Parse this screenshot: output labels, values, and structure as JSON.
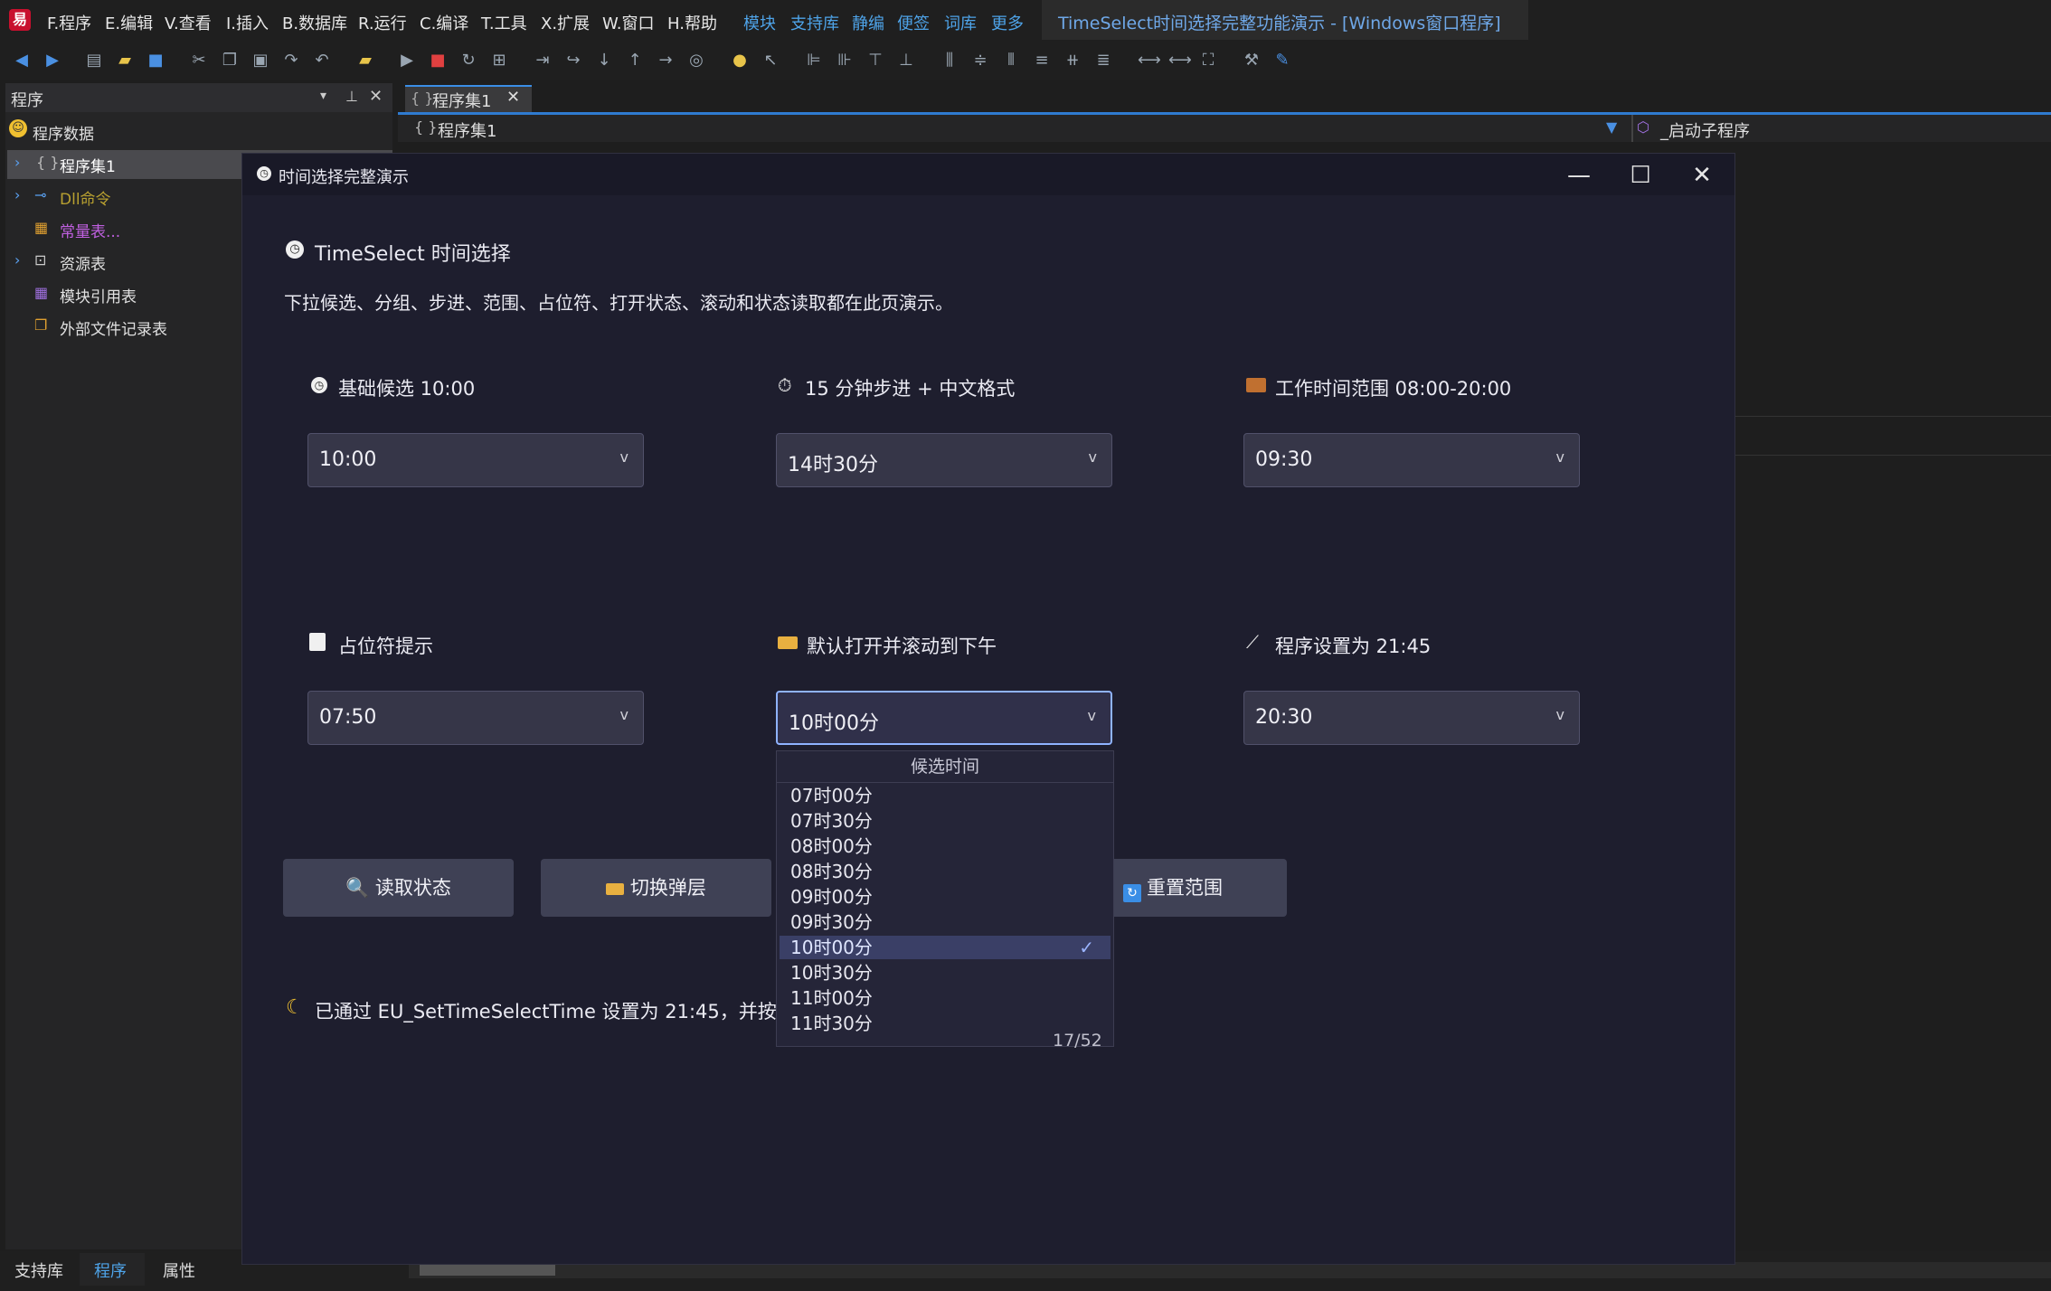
{
  "ide": {
    "menus": [
      "F.程序",
      "E.编辑",
      "V.查看",
      "I.插入",
      "B.数据库",
      "R.运行",
      "C.编译",
      "T.工具",
      "X.扩展",
      "W.窗口",
      "H.帮助"
    ],
    "links": [
      "模块",
      "支持库",
      "静编",
      "便签",
      "词库",
      "更多"
    ],
    "title": "TimeSelect时间选择完整功能演示 - [Windows窗口程序]"
  },
  "left_panel": {
    "title": "程序",
    "items": [
      "程序数据",
      "程序集1",
      "Dll命令",
      "常量表...",
      "资源表",
      "模块引用表",
      "外部文件记录表"
    ]
  },
  "bottom_tabs": [
    "支持库",
    "程序",
    "属性"
  ],
  "editor": {
    "tab_label": "程序集1",
    "header_left": "程序集1",
    "header_right": "_启动子程序"
  },
  "dialog": {
    "title": "时间选择完整演示",
    "heading": "TimeSelect 时间选择",
    "description": "下拉候选、分组、步进、范围、占位符、打开状态、滚动和状态读取都在此页演示。",
    "fields": [
      {
        "label": "基础候选 10:00",
        "value": "10:00"
      },
      {
        "label": "15 分钟步进 + 中文格式",
        "value": "14时30分"
      },
      {
        "label": "工作时间范围 08:00-20:00",
        "value": "09:30"
      },
      {
        "label": "占位符提示",
        "value": "07:50"
      },
      {
        "label": "默认打开并滚动到下午",
        "value": "10时00分"
      },
      {
        "label": "程序设置为 21:45",
        "value": "20:30"
      }
    ],
    "buttons": [
      "读取状态",
      "切换弹层",
      "重置范围"
    ],
    "status": "已通过 EU_SetTimeSelectTime 设置为 21:45，并按当"
  },
  "dropdown": {
    "header": "候选时间",
    "options": [
      "07时00分",
      "07时30分",
      "08时00分",
      "08时30分",
      "09时00分",
      "09时30分",
      "10时00分",
      "10时30分",
      "11时00分",
      "11时30分"
    ],
    "selected_index": 6,
    "count": "17/52"
  },
  "colors": {
    "accent": "#3a8ee6",
    "dialog_bg": "#1e1e2e",
    "select_bg": "#363648",
    "selected_option": "#3a3f66"
  }
}
